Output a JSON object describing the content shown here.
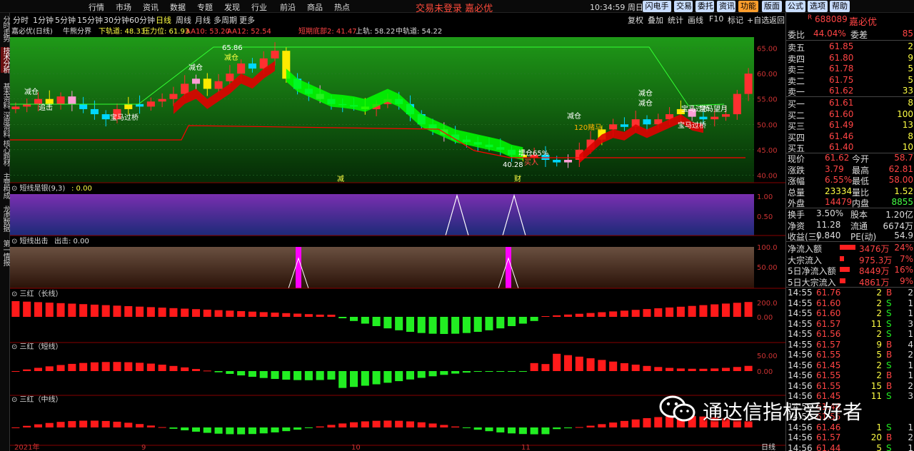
{
  "topmenu": [
    "行情",
    "市场",
    "资讯",
    "数据",
    "专题",
    "发现",
    "行业",
    "前沿",
    "商品",
    "热点"
  ],
  "title": "交易未登录  嘉必优",
  "clock": "10:34:59",
  "weekday": "周日",
  "topbuttons": [
    "闪电手",
    "交易",
    "委托",
    "资讯",
    "功能",
    "版面",
    "公式",
    "选项",
    "帮助"
  ],
  "periods": [
    "分时",
    "1分钟",
    "5分钟",
    "15分钟",
    "30分钟",
    "60分钟",
    "日线",
    "周线",
    "月线",
    "多周期",
    "更多"
  ],
  "active_period": "日线",
  "tools": [
    "复权",
    "叠加",
    "统计",
    "画线",
    "F10",
    "标记",
    "+自选",
    "返回"
  ],
  "leftbar": [
    "分时走势",
    "技术分析",
    "基本资料",
    "深度资料",
    "核心题材",
    "主营构成",
    "龙虎数据",
    "第一情报"
  ],
  "main": {
    "name": "嘉必优(日线)",
    "indicator": "牛熊分界",
    "lower": "下轨道: 48.33",
    "pressure": "压力位: 61.93",
    "aa10": "AA10: 53.20",
    "aa12": "AA12: 52.54",
    "bottom": "短期底部2: 41.47",
    "upper": "上轨: 58.22",
    "middle": "中轨道: 54.22",
    "yticks": [
      "65.00",
      "60.00",
      "55.00",
      "50.00",
      "45.00",
      "40.00"
    ],
    "high_label": "65.86",
    "low_label": "40.28",
    "annotations": [
      "减仓",
      "追击",
      "宝马过桥",
      "减仓",
      "减仓",
      "减仓",
      "120赌马",
      "宝马过桥",
      "宝马过桥",
      "宝马望月",
      "减仓",
      "买入",
      "减仓",
      "增仓65%"
    ],
    "bottom_tags": [
      "减",
      "财"
    ]
  },
  "panel1": {
    "title": "短线是银(9,3)",
    "value": ": 0.00",
    "yticks": [
      "1.00",
      "0.50"
    ]
  },
  "panel2": {
    "title": "短线出击",
    "value": "出击: 0.00",
    "yticks": [
      "100.0",
      "50.00"
    ]
  },
  "panel3": {
    "title": "三红（长线）",
    "yticks": [
      "200.0",
      "0.00"
    ]
  },
  "panel4": {
    "title": "三红（短线）",
    "yticks": [
      "50.00",
      "0.00"
    ]
  },
  "panel5": {
    "title": "三红（中线）"
  },
  "xaxis": {
    "labels": [
      "2021年",
      "9",
      "10",
      "11"
    ],
    "right": "日线"
  },
  "quote": {
    "code": "688089",
    "name": "嘉必优",
    "mark": "R",
    "webi_label": "委比",
    "webi": "44.04%",
    "wecha_label": "委差",
    "wecha": "85",
    "asks": [
      {
        "label": "卖五",
        "price": "61.85",
        "vol": "2"
      },
      {
        "label": "卖四",
        "price": "61.80",
        "vol": "9"
      },
      {
        "label": "卖三",
        "price": "61.78",
        "vol": "5"
      },
      {
        "label": "卖二",
        "price": "61.75",
        "vol": "5"
      },
      {
        "label": "卖一",
        "price": "61.62",
        "vol": "33"
      }
    ],
    "bids": [
      {
        "label": "买一",
        "price": "61.61",
        "vol": "8"
      },
      {
        "label": "买二",
        "price": "61.60",
        "vol": "100"
      },
      {
        "label": "买三",
        "price": "61.49",
        "vol": "13"
      },
      {
        "label": "买四",
        "price": "61.46",
        "vol": "8"
      },
      {
        "label": "买五",
        "price": "61.40",
        "vol": "10"
      }
    ],
    "stats": [
      {
        "l1": "现价",
        "v1": "61.62",
        "c1": "#ff4444",
        "l2": "今开",
        "v2": "58.7",
        "c2": "#ff4444"
      },
      {
        "l1": "涨跌",
        "v1": "3.79",
        "c1": "#ff4444",
        "l2": "最高",
        "v2": "62.81",
        "c2": "#ff4444"
      },
      {
        "l1": "涨幅",
        "v1": "6.55%",
        "c1": "#ff4444",
        "l2": "最低",
        "v2": "58.00",
        "c2": "#ff4444"
      },
      {
        "l1": "总量",
        "v1": "23334",
        "c1": "#ffff44",
        "l2": "量比",
        "v2": "1.52",
        "c2": "#ffff44"
      },
      {
        "l1": "外盘",
        "v1": "14479",
        "c1": "#ff4444",
        "l2": "内盘",
        "v2": "8855",
        "c2": "#44ff44"
      }
    ],
    "stats2": [
      {
        "l1": "换手",
        "v1": "3.50%",
        "l2": "股本",
        "v2": "1.20亿"
      },
      {
        "l1": "净资",
        "v1": "11.28",
        "l2": "流通",
        "v2": "6674万"
      },
      {
        "l1": "收益(三)",
        "v1": "0.840",
        "l2": "PE(动)",
        "v2": "54.9"
      }
    ],
    "flows": [
      {
        "label": "净流入额",
        "value": "3476万",
        "pct": "24%",
        "bar": 0.24
      },
      {
        "label": "大宗流入",
        "value": "975.3万",
        "pct": "7%",
        "bar": 0.07
      },
      {
        "label": "5日净流入额",
        "value": "8449万",
        "pct": "16%",
        "bar": 0.16
      },
      {
        "label": "5日大宗流入",
        "value": "4861万",
        "pct": "9%",
        "bar": 0.09
      }
    ],
    "ticks": [
      {
        "t": "14:55",
        "p": "61.76",
        "v": "2",
        "bs": "B",
        "n": "2"
      },
      {
        "t": "14:55",
        "p": "61.60",
        "v": "2",
        "bs": "S",
        "n": "1"
      },
      {
        "t": "14:55",
        "p": "61.60",
        "v": "2",
        "bs": "S",
        "n": "1"
      },
      {
        "t": "14:55",
        "p": "61.57",
        "v": "11",
        "bs": "S",
        "n": "3"
      },
      {
        "t": "14:55",
        "p": "61.56",
        "v": "2",
        "bs": "S",
        "n": "1"
      },
      {
        "t": "14:55",
        "p": "61.57",
        "v": "9",
        "bs": "B",
        "n": "4"
      },
      {
        "t": "14:56",
        "p": "61.55",
        "v": "5",
        "bs": "B",
        "n": "2"
      },
      {
        "t": "14:56",
        "p": "61.45",
        "v": "2",
        "bs": "S",
        "n": "1"
      },
      {
        "t": "14:56",
        "p": "61.55",
        "v": "2",
        "bs": "B",
        "n": "1"
      },
      {
        "t": "14:56",
        "p": "61.55",
        "v": "15",
        "bs": "B",
        "n": "2"
      },
      {
        "t": "14:56",
        "p": "61.45",
        "v": "11",
        "bs": "S",
        "n": "3"
      },
      {
        "t": "14:56",
        "p": "61.46",
        "v": "",
        "bs": "",
        "n": ""
      },
      {
        "t": "14:56",
        "p": "61.55",
        "v": "",
        "bs": "",
        "n": ""
      },
      {
        "t": "14:56",
        "p": "61.46",
        "v": "1",
        "bs": "S",
        "n": "1"
      },
      {
        "t": "14:56",
        "p": "61.57",
        "v": "20",
        "bs": "B",
        "n": "2"
      },
      {
        "t": "14:56",
        "p": "61.44",
        "v": "5",
        "bs": "S",
        "n": "1"
      }
    ]
  },
  "watermark": "通达信指标爱好者",
  "colors": {
    "up": "#ff3030",
    "down": "#00e5ff",
    "yellow": "#ffff00",
    "green_bg": "#0a7a10",
    "label_red": "#ff4444"
  }
}
